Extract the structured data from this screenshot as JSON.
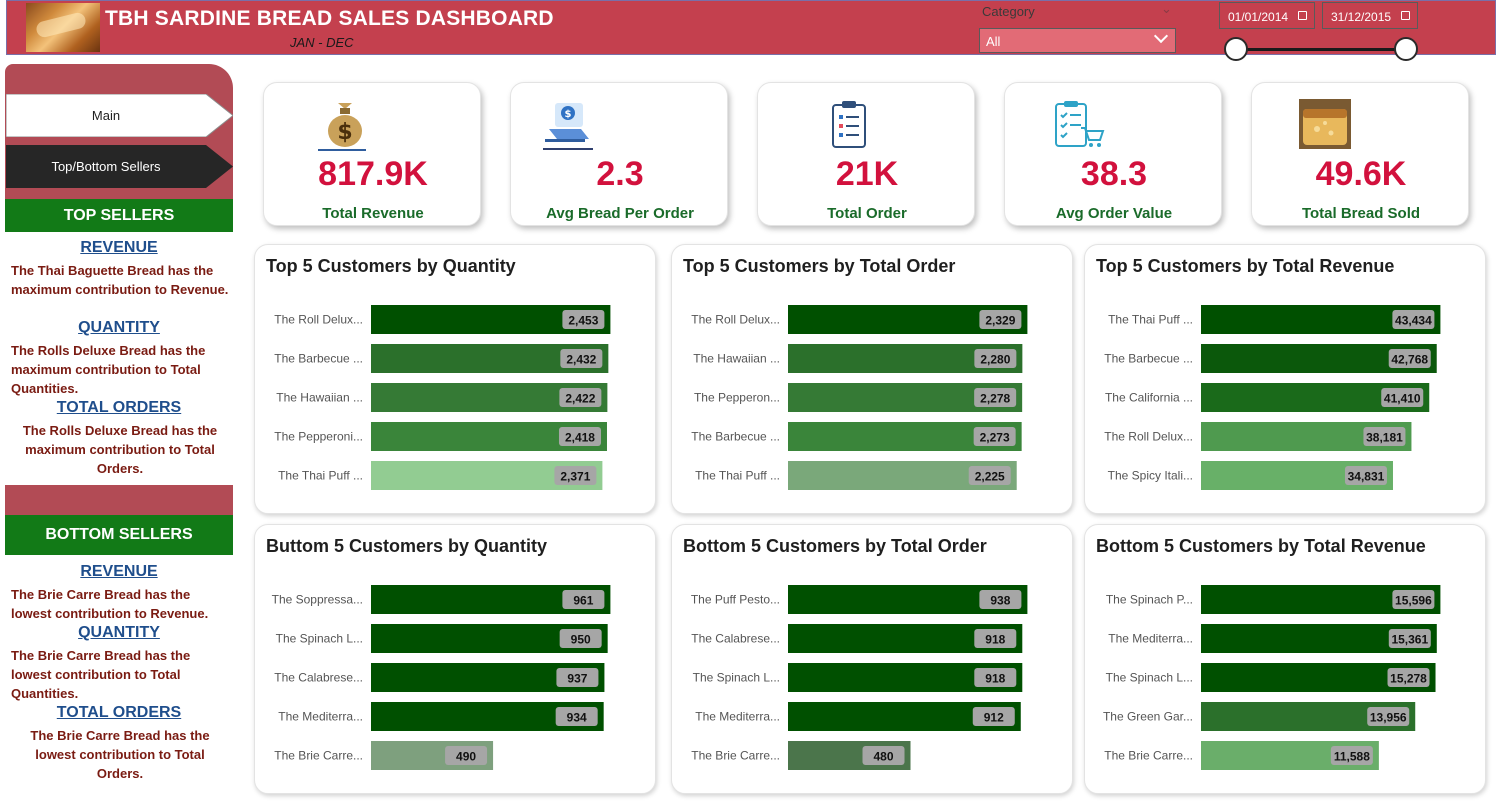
{
  "header": {
    "title": "TBH SARDINE BREAD SALES DASHBOARD",
    "subtitle": "JAN - DEC",
    "category_label": "Category",
    "category_value": "All",
    "date_start": "01/01/2014",
    "date_end": "31/12/2015",
    "range_start_fraction": 0,
    "range_end_fraction": 1
  },
  "nav": {
    "main": "Main",
    "top_bottom": "Top/Bottom Sellers"
  },
  "top_sellers": {
    "title": "TOP SELLERS",
    "revenue_heading": "REVENUE",
    "revenue_text": "The Thai Baguette Bread  has the maximum contribution to Revenue.",
    "quantity_heading": "QUANTITY",
    "quantity_text": "The Rolls Deluxe Bread has the maximum contribution to Total Quantities.",
    "orders_heading": "TOTAL ORDERS",
    "orders_text": "The Rolls Deluxe Bread has the maximum contribution to Total Orders."
  },
  "bottom_sellers": {
    "title": "BOTTOM SELLERS",
    "revenue_heading": "REVENUE",
    "revenue_text": "The Brie Carre Bread has the lowest contribution to Revenue.",
    "quantity_heading": "QUANTITY",
    "quantity_text": "The Brie Carre Bread has the lowest contribution to Total Quantities.",
    "orders_heading": "TOTAL ORDERS",
    "orders_text": "The Brie Carre Bread has the lowest contribution to Total Orders."
  },
  "kpis": [
    {
      "value": "817.9K",
      "label": "Total Revenue",
      "icon": "money-bag-icon"
    },
    {
      "value": "2.3",
      "label": "Avg Bread Per Order",
      "icon": "laptop-payment-icon"
    },
    {
      "value": "21K",
      "label": "Total Order",
      "icon": "clipboard-list-icon"
    },
    {
      "value": "38.3",
      "label": "Avg Order Value",
      "icon": "checklist-cart-icon"
    },
    {
      "value": "49.6K",
      "label": "Total Bread Sold",
      "icon": "bread-photo-icon"
    }
  ],
  "colors": {
    "header_bg": "#c4404e",
    "sidebar_bg": "#b24b55",
    "panel_head": "#127a17",
    "kpi_value": "#d2113d",
    "kpi_label": "#1a6b2a",
    "nav_active_bg": "#262626"
  },
  "chart_data": [
    {
      "type": "bar",
      "orientation": "horizontal",
      "title": "Top 5 Customers by Quantity",
      "categories": [
        "The Roll Delux...",
        "The Barbecue ...",
        "The Hawaiian ...",
        "The Pepperoni...",
        "The Thai Puff ..."
      ],
      "values": [
        2453,
        2432,
        2422,
        2418,
        2371
      ],
      "labels": [
        "2,453",
        "2,432",
        "2,422",
        "2,418",
        "2,371"
      ],
      "colors": [
        "#005000",
        "#2b702b",
        "#357a35",
        "#3a853a",
        "#92cc92"
      ]
    },
    {
      "type": "bar",
      "orientation": "horizontal",
      "title": "Top 5 Customers by Total Order",
      "categories": [
        "The Roll Delux...",
        "The Hawaiian ...",
        "The Pepperon...",
        "The Barbecue ...",
        "The Thai Puff ..."
      ],
      "values": [
        2329,
        2280,
        2278,
        2273,
        2225
      ],
      "labels": [
        "2,329",
        "2,280",
        "2,278",
        "2,273",
        "2,225"
      ],
      "colors": [
        "#005000",
        "#2b702b",
        "#357a35",
        "#3a853a",
        "#7aa87a"
      ]
    },
    {
      "type": "bar",
      "orientation": "horizontal",
      "title": "Top 5 Customers by Total Revenue",
      "categories": [
        "The Thai Puff ...",
        "The Barbecue ...",
        "The California ...",
        "The Roll Delux...",
        "The Spicy Itali..."
      ],
      "values": [
        43434,
        42768,
        41410,
        38181,
        34831
      ],
      "labels": [
        "43,434",
        "42,768",
        "41,410",
        "38,181",
        "34,831"
      ],
      "colors": [
        "#005000",
        "#0b580b",
        "#1a6a1a",
        "#4f9a4f",
        "#68b068"
      ]
    },
    {
      "type": "bar",
      "orientation": "horizontal",
      "title": "Buttom 5 Customers by Quantity",
      "categories": [
        "The Soppressa...",
        "The Spinach L...",
        "The Calabrese...",
        "The Mediterra...",
        "The Brie Carre..."
      ],
      "values": [
        961,
        950,
        937,
        934,
        490
      ],
      "labels": [
        "961",
        "950",
        "937",
        "934",
        "490"
      ],
      "colors": [
        "#005000",
        "#005000",
        "#005000",
        "#005000",
        "#7ea07e"
      ]
    },
    {
      "type": "bar",
      "orientation": "horizontal",
      "title": "Bottom 5 Customers by Total Order",
      "categories": [
        "The Puff Pesto...",
        "The Calabrese...",
        "The Spinach L...",
        "The Mediterra...",
        "The Brie Carre..."
      ],
      "values": [
        938,
        918,
        918,
        912,
        480
      ],
      "labels": [
        "938",
        "918",
        "918",
        "912",
        "480"
      ],
      "colors": [
        "#005000",
        "#005000",
        "#005000",
        "#005000",
        "#4b754b"
      ]
    },
    {
      "type": "bar",
      "orientation": "horizontal",
      "title": "Bottom 5 Customers by Total Revenue",
      "categories": [
        "The Spinach P...",
        "The Mediterra...",
        "The Spinach L...",
        "The Green Gar...",
        "The Brie Carre..."
      ],
      "values": [
        15596,
        15361,
        15278,
        13956,
        11588
      ],
      "labels": [
        "15,596",
        "15,361",
        "15,278",
        "13,956",
        "11,588"
      ],
      "colors": [
        "#005000",
        "#005000",
        "#005000",
        "#2b702b",
        "#6aae6a"
      ]
    }
  ]
}
